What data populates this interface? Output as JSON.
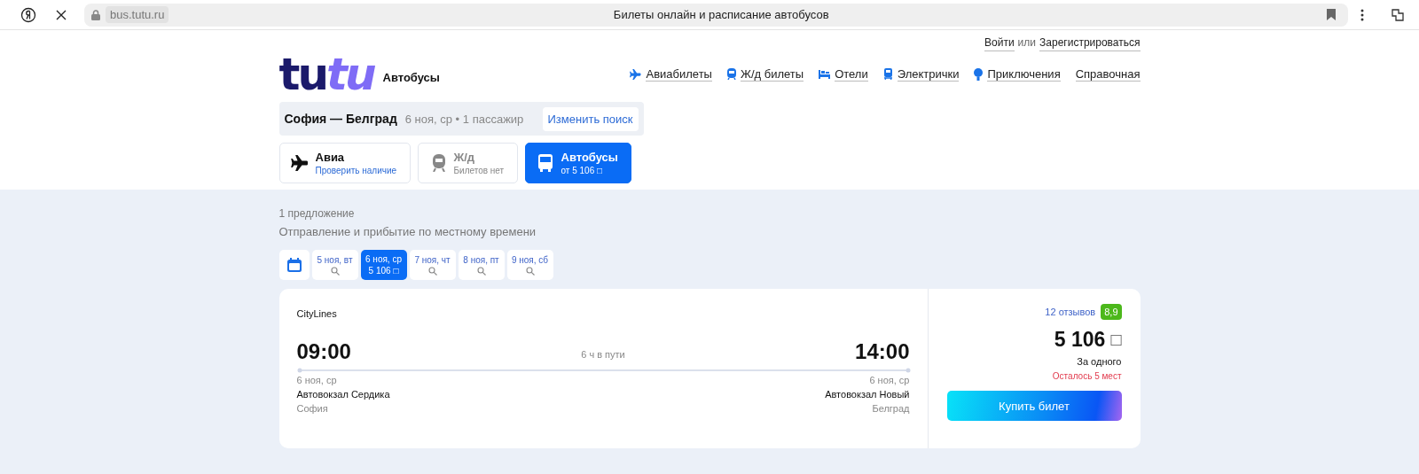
{
  "browser": {
    "domain": "bus.tutu.ru",
    "title": "Билеты онлайн и расписание автобусов"
  },
  "auth": {
    "login": "Войти",
    "or": "или",
    "register": "Зарегистрироваться"
  },
  "logo": {
    "part_1": "tu",
    "part_2": "tu",
    "section": "Автобусы"
  },
  "nav": [
    {
      "label": "Авиабилеты",
      "kind": "plane"
    },
    {
      "label": "Ж/д билеты",
      "kind": "train"
    },
    {
      "label": "Отели",
      "kind": "hotel"
    },
    {
      "label": "Электрички",
      "kind": "suburban"
    },
    {
      "label": "Приключения",
      "kind": "balloon"
    },
    {
      "label": "Справочная",
      "kind": "none"
    }
  ],
  "search": {
    "route": "София — Белград",
    "details": "6 ноя, ср • 1 пассажир",
    "button": "Изменить поиск"
  },
  "transport_tabs": [
    {
      "kind": "plane",
      "label": "Авиа",
      "sub": "Проверить наличие",
      "selected": false,
      "disabled": false
    },
    {
      "kind": "train",
      "label": "Ж/д",
      "sub": "Билетов нет",
      "selected": false,
      "disabled": true
    },
    {
      "kind": "bus",
      "label": "Автобусы",
      "sub": "от 5 106 □",
      "selected": true,
      "disabled": false
    }
  ],
  "results": {
    "count": "1 предложение",
    "note": "Отправление и прибытие по местному времени"
  },
  "dates": [
    {
      "label": "5 ноя, вт",
      "selected": false
    },
    {
      "label": "6 ноя, ср",
      "price": "5 106 □",
      "selected": true
    },
    {
      "label": "7 ноя, чт",
      "selected": false
    },
    {
      "label": "8 ноя, пт",
      "selected": false
    },
    {
      "label": "9 ноя, сб",
      "selected": false
    }
  ],
  "trip": {
    "carrier": "CityLines",
    "depart_time": "09:00",
    "duration": "6 ч в пути",
    "arrive_time": "14:00",
    "depart_date": "6 ноя, ср",
    "arrive_date": "6 ноя, ср",
    "depart_station": "Автовокзал Сердика",
    "arrive_station": "Автовокзал Новый",
    "depart_city": "София",
    "arrive_city": "Белград",
    "reviews": "12 отзывов",
    "rating": "8,9",
    "price": "5 106",
    "currency": "□",
    "price_note": "За одного",
    "seats_left": "Осталось 5 мест",
    "buy": "Купить билет"
  }
}
